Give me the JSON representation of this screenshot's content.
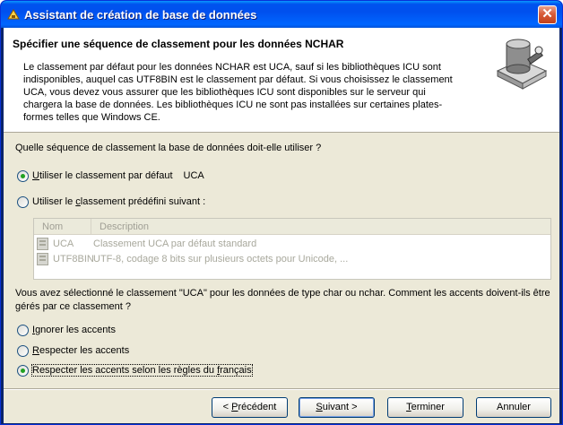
{
  "window": {
    "title": "Assistant de création de base de données",
    "close_glyph": "✕"
  },
  "header": {
    "title": "Spécifier une séquence de classement pour les données NCHAR",
    "description": "Le classement par défaut pour les données NCHAR est UCA, sauf si les bibliothèques ICU sont indisponibles, auquel cas UTF8BIN est le classement par défaut. Si vous choisissez le classement UCA, vous devez vous assurer que les bibliothèques ICU sont disponibles sur le serveur qui chargera la base de données. Les bibliothèques ICU ne sont pas installées sur certaines plates-formes telles que Windows CE.",
    "graphic_icon": "database-wizard-icon"
  },
  "collation": {
    "question": "Quelle séquence de classement la base de données doit-elle utiliser ?",
    "option_default": {
      "label_pre": "",
      "label_u": "U",
      "label_post": "tiliser le classement par défaut",
      "value": "UCA",
      "selected": true
    },
    "option_predefined": {
      "label_pre": "Utiliser le ",
      "label_u": "c",
      "label_post": "lassement prédéfini suivant :",
      "selected": false
    },
    "list": {
      "columns": [
        "Nom",
        "Description"
      ],
      "rows": [
        {
          "name": "UCA",
          "description": "Classement UCA par défaut standard"
        },
        {
          "name": "UTF8BIN",
          "description": "UTF-8, codage 8 bits sur plusieurs octets pour Unicode, ..."
        }
      ]
    }
  },
  "accents": {
    "question": "Vous avez sélectionné le classement \"UCA\" pour les données de type char ou nchar. Comment les accents doivent-ils être gérés par ce classement ?",
    "options": [
      {
        "label_pre": "",
        "label_u": "I",
        "label_post": "gnorer les accents",
        "selected": false
      },
      {
        "label_pre": "",
        "label_u": "R",
        "label_post": "especter les accents",
        "selected": false
      },
      {
        "label_pre": "Respecter les accents selon les règles du ",
        "label_u": "f",
        "label_post": "rançais",
        "selected": true
      }
    ]
  },
  "buttons": {
    "back": {
      "pre": "< ",
      "u": "P",
      "post": "récédent"
    },
    "next": {
      "pre": "",
      "u": "S",
      "post": "uivant >"
    },
    "finish": {
      "pre": "",
      "u": "T",
      "post": "erminer"
    },
    "cancel": {
      "pre": "Annuler",
      "u": "",
      "post": ""
    }
  },
  "colors": {
    "titlebar": "#0053ee",
    "dialog_bg": "#ece9d8",
    "radio_dot": "#21a121",
    "disabled_text": "#a8a89c"
  }
}
